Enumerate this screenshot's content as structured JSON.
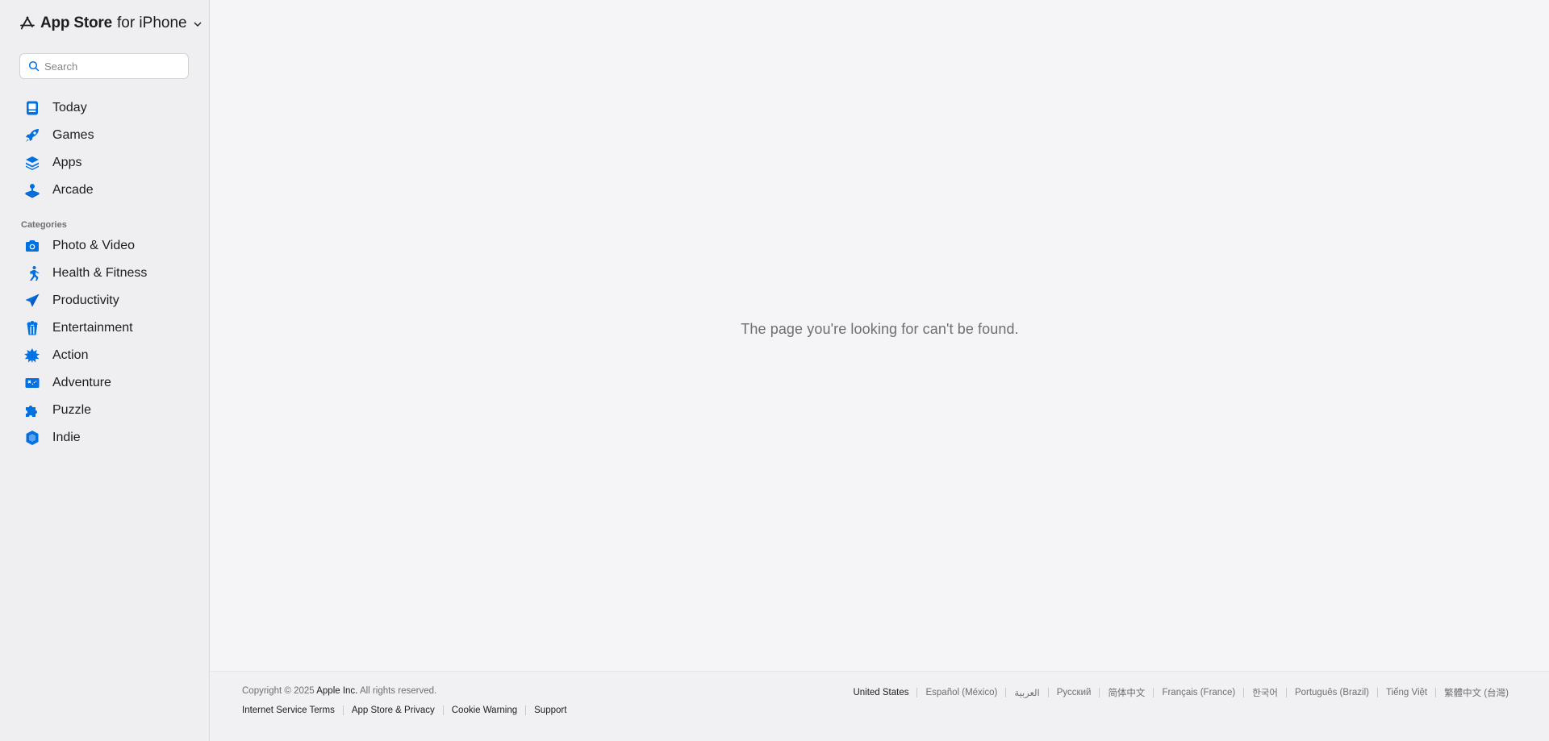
{
  "brand": {
    "store": "App Store",
    "suffix": "for iPhone"
  },
  "search": {
    "placeholder": "Search"
  },
  "nav": {
    "main": [
      {
        "label": "Today",
        "icon": "today-icon"
      },
      {
        "label": "Games",
        "icon": "rocket-icon"
      },
      {
        "label": "Apps",
        "icon": "layers-icon"
      },
      {
        "label": "Arcade",
        "icon": "joystick-icon"
      }
    ],
    "categories_label": "Categories",
    "categories": [
      {
        "label": "Photo & Video",
        "icon": "camera-icon"
      },
      {
        "label": "Health & Fitness",
        "icon": "runner-icon"
      },
      {
        "label": "Productivity",
        "icon": "paper-plane-icon"
      },
      {
        "label": "Entertainment",
        "icon": "popcorn-icon"
      },
      {
        "label": "Action",
        "icon": "burst-icon"
      },
      {
        "label": "Adventure",
        "icon": "map-icon"
      },
      {
        "label": "Puzzle",
        "icon": "puzzle-icon"
      },
      {
        "label": "Indie",
        "icon": "shield-icon"
      }
    ]
  },
  "main": {
    "message": "The page you're looking for can't be found."
  },
  "footer": {
    "copyright_prefix": "Copyright © 2025",
    "company": "Apple Inc.",
    "rights": "All rights reserved.",
    "legal": [
      "Internet Service Terms",
      "App Store & Privacy",
      "Cookie Warning",
      "Support"
    ],
    "languages": [
      "United States",
      "Español (México)",
      "العربية",
      "Русский",
      "简体中文",
      "Français (France)",
      "한국어",
      "Português (Brazil)",
      "Tiếng Việt",
      "繁體中文 (台灣)"
    ]
  },
  "colors": {
    "accent": "#0071e3",
    "sidebar_bg": "#efeff2",
    "page_bg": "#f5f5f7"
  }
}
